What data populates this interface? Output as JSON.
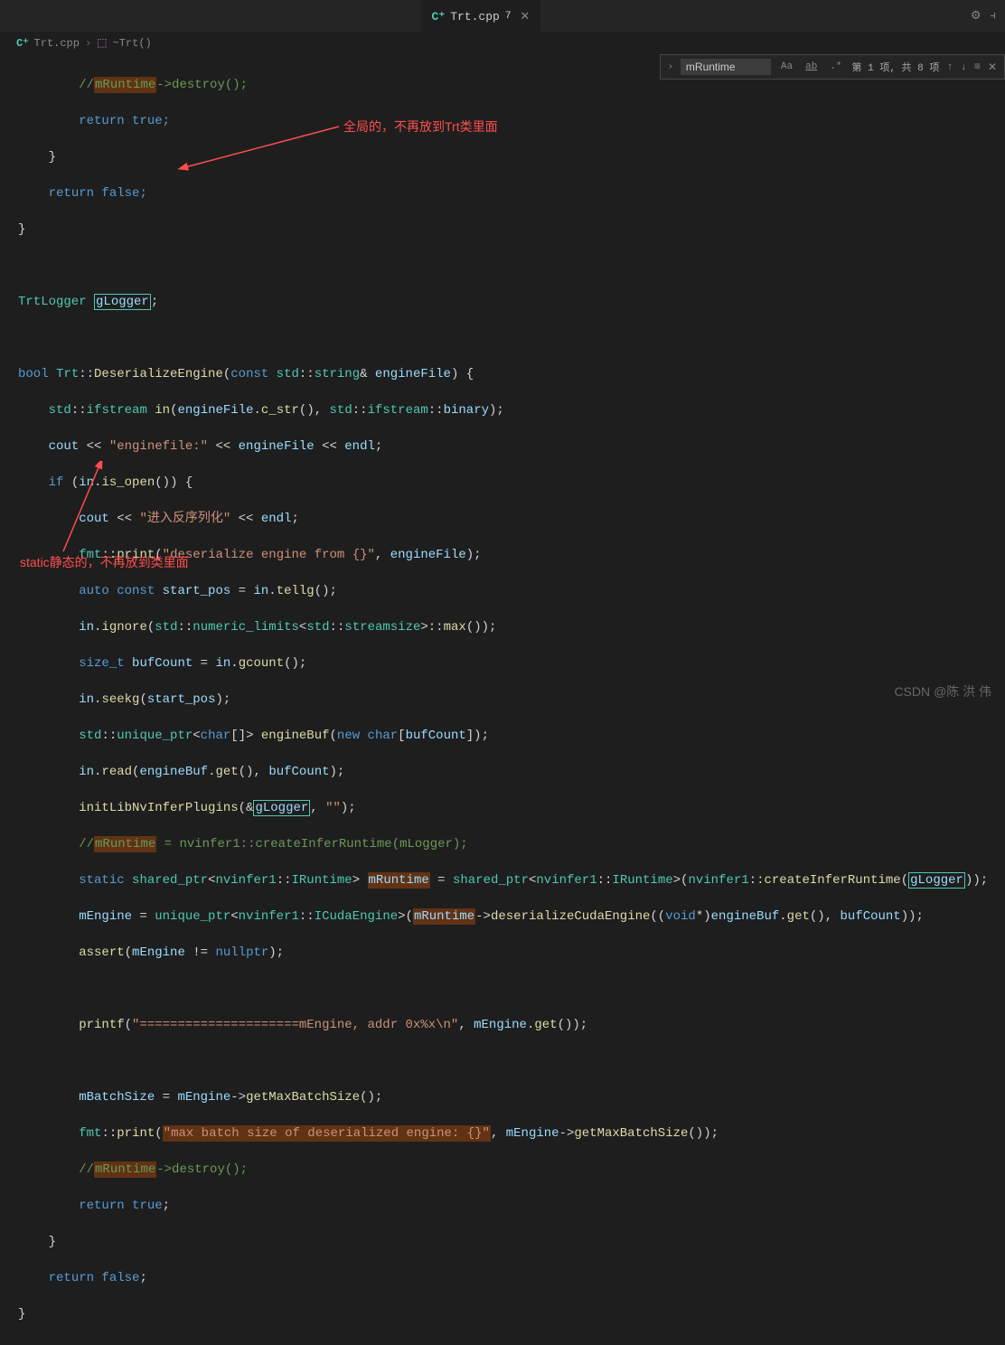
{
  "tab": {
    "filename": "Trt.cpp",
    "modified_badge": "7",
    "icon": "C⁺"
  },
  "breadcrumb": {
    "file": "Trt.cpp",
    "symbol": "~Trt()",
    "icon": "C⁺",
    "cube": "⬚"
  },
  "search": {
    "value": "mRuntime",
    "result_text": "第 1 项, 共 8 项",
    "opt_case": "Aa",
    "opt_word": "ab",
    "opt_regex": ".*"
  },
  "annotations": {
    "global": "全局的，不再放到Trt类里面",
    "static": "static静态的，不再放到类里面"
  },
  "code": {
    "l1_comment": "mRuntime",
    "l1_rest": "->destroy();",
    "l2": "return",
    "l2r": " true;",
    "l4": "return",
    "l4r": " false;",
    "l6_type": "TrtLogger ",
    "l6_var": "gLogger",
    "l6_end": ";",
    "l8_bool": "bool",
    "l8_cls": " Trt",
    "l8_func": "DeserializeEngine",
    "l8_const": "const",
    "l8_std": " std",
    "l8_string": "string",
    "l8_amp": "&",
    "l8_param": " engineFile",
    "l9_std": "std",
    "l9_ifs": "ifstream",
    "l9_in": " in",
    "l9_ef": "engineFile",
    "l9_cstr": "c_str",
    "l9_std2": "std",
    "l9_ifs2": "ifstream",
    "l9_bin": "binary",
    "l10_cout": "cout",
    "l10_str": "\"enginefile:\"",
    "l10_ef": "engineFile",
    "l10_endl": "endl",
    "l11_if": "if",
    "l11_in": "in",
    "l11_open": "is_open",
    "l12_cout": "cout",
    "l12_str": "\"进入反序列化\"",
    "l12_endl": "endl",
    "l13_fmt": "fmt",
    "l13_print": "print",
    "l13_str": "\"deserialize engine from {}\"",
    "l13_ef": "engineFile",
    "l14_auto": "auto",
    "l14_const": " const",
    "l14_sp": " start_pos",
    "l14_in": "in",
    "l14_tellg": "tellg",
    "l15_in": "in",
    "l15_ignore": "ignore",
    "l15_std": "std",
    "l15_nl": "numeric_limits",
    "l15_std2": "std",
    "l15_ss": "streamsize",
    "l15_max": "max",
    "l16_sizet": "size_t",
    "l16_bc": " bufCount",
    "l16_in": "in",
    "l16_gc": "gcount",
    "l17_in": "in",
    "l17_seekg": "seekg",
    "l17_sp": "start_pos",
    "l18_std": "std",
    "l18_up": "unique_ptr",
    "l18_char": "char",
    "l18_eb": " engineBuf",
    "l18_new": "new",
    "l18_char2": " char",
    "l18_bc": "bufCount",
    "l19_in": "in",
    "l19_read": "read",
    "l19_eb": "engineBuf",
    "l19_get": "get",
    "l19_bc": "bufCount",
    "l20_init": "initLibNvInferPlugins",
    "l20_gl": "gLogger",
    "l20_str": "\"\"",
    "l21_comment": "//",
    "l21_mr": "mRuntime",
    "l21_rest": " = nvinfer1::createInferRuntime(mLogger);",
    "l22_static": "static",
    "l22_sp": " shared_ptr",
    "l22_nv": "nvinfer1",
    "l22_ir": "IRuntime",
    "l22_mr": "mRuntime",
    "l22_sp2": "shared_ptr",
    "l22_nv2": "nvinfer1",
    "l22_ir2": "IRuntime",
    "l22_nv3": "nvinfer1",
    "l22_cir": "createInferRuntime",
    "l22_gl": "gLogger",
    "l23_me": "mEngine",
    "l23_up": "unique_ptr",
    "l23_nv": "nvinfer1",
    "l23_ice": "ICudaEngine",
    "l23_mr": "mRuntime",
    "l23_dce": "deserializeCudaEngine",
    "l23_void": "void",
    "l23_eb": "engineBuf",
    "l23_get": "get",
    "l23_bc": "bufCount",
    "l24_assert": "assert",
    "l24_me": "mEngine",
    "l24_np": "nullptr",
    "l26_printf": "printf",
    "l26_str": "\"=====================mEngine, addr 0x%x\\n\"",
    "l26_me": "mEngine",
    "l26_get": "get",
    "l28_mbs": "mBatchSize",
    "l28_me": "mEngine",
    "l28_gmbs": "getMaxBatchSize",
    "l29_fmt": "fmt",
    "l29_print": "print",
    "l29_str": "\"max batch size of deserialized engine: {}\"",
    "l29_me": "mEngine",
    "l29_gmbs": "getMaxBatchSize",
    "l30_comment": "//",
    "l30_mr": "mRuntime",
    "l30_rest": "->destroy();",
    "l31_return": "return",
    "l31_true": " true",
    "l33_return": "return",
    "l33_false": " false"
  },
  "watermark": "CSDN @陈 洪 伟"
}
